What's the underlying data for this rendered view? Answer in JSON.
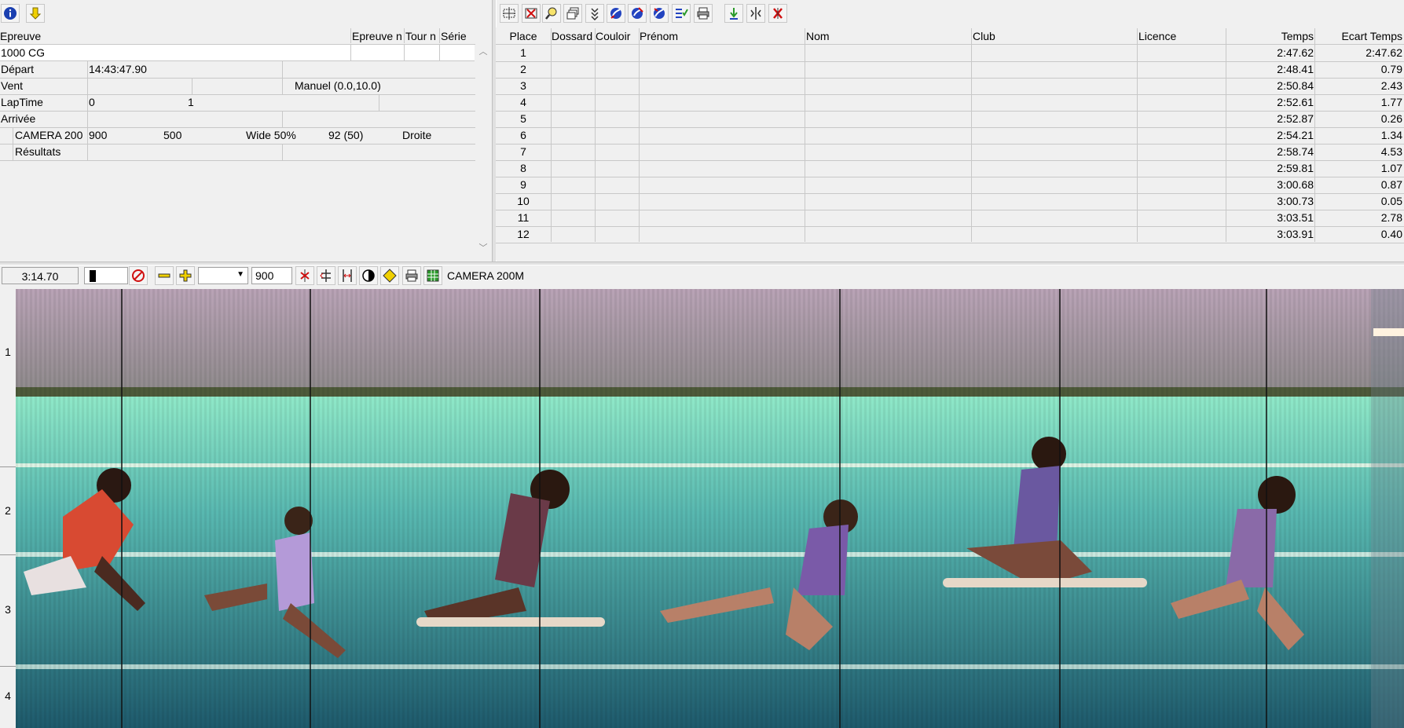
{
  "left_panel": {
    "headers": [
      "Epreuve",
      "Epreuve n",
      "Tour n",
      "Série"
    ],
    "rows": [
      {
        "label": "1000 CG",
        "v1": "",
        "v2": "",
        "v3": "",
        "v4": ""
      },
      {
        "label": "Départ",
        "v1": "14:43:47.90",
        "v2": "",
        "v3": "",
        "v4": ""
      },
      {
        "label": "Vent",
        "v1": "",
        "v2": "",
        "v3": "Manuel (0.0,10.0)",
        "v4": ""
      },
      {
        "label": "LapTime",
        "v1": "0",
        "v2": "1",
        "v3": "",
        "v4": ""
      },
      {
        "label": "Arrivée",
        "v1": "",
        "v2": "",
        "v3": "",
        "v4": ""
      }
    ],
    "camera_row": {
      "label": "CAMERA 200",
      "c1": "900",
      "c2": "500",
      "c3": "Wide 50%",
      "c4": "92  (50)",
      "c5": "Droite"
    },
    "results_row": {
      "label": "Résultats"
    }
  },
  "results_table": {
    "headers": {
      "place": "Place",
      "dossard": "Dossard",
      "couloir": "Couloir",
      "prenom": "Prénom",
      "nom": "Nom",
      "club": "Club",
      "licence": "Licence",
      "temps": "Temps",
      "ecart": "Ecart Temps"
    },
    "rows": [
      {
        "place": "1",
        "temps": "2:47.62",
        "ecart": "2:47.62"
      },
      {
        "place": "2",
        "temps": "2:48.41",
        "ecart": "0.79"
      },
      {
        "place": "3",
        "temps": "2:50.84",
        "ecart": "2.43"
      },
      {
        "place": "4",
        "temps": "2:52.61",
        "ecart": "1.77"
      },
      {
        "place": "5",
        "temps": "2:52.87",
        "ecart": "0.26"
      },
      {
        "place": "6",
        "temps": "2:54.21",
        "ecart": "1.34"
      },
      {
        "place": "7",
        "temps": "2:58.74",
        "ecart": "4.53"
      },
      {
        "place": "8",
        "temps": "2:59.81",
        "ecart": "1.07"
      },
      {
        "place": "9",
        "temps": "3:00.68",
        "ecart": "0.87"
      },
      {
        "place": "10",
        "temps": "3:00.73",
        "ecart": "0.05"
      },
      {
        "place": "11",
        "temps": "3:03.51",
        "ecart": "2.78"
      },
      {
        "place": "12",
        "temps": "3:03.91",
        "ecart": "0.40"
      }
    ]
  },
  "photo_toolbar": {
    "time": "3:14.70",
    "zoom_value": "900",
    "camera_label": "CAMERA 200M"
  },
  "lanes": [
    "1",
    "2",
    "3",
    "4"
  ],
  "icons": {
    "info": "info-icon",
    "download": "arrow-down-icon"
  },
  "colors": {
    "info_blue": "#1a3fb0",
    "arrow_yellow": "#f0d000",
    "red_icon": "#d01010",
    "green_icon": "#2a9a2a"
  }
}
